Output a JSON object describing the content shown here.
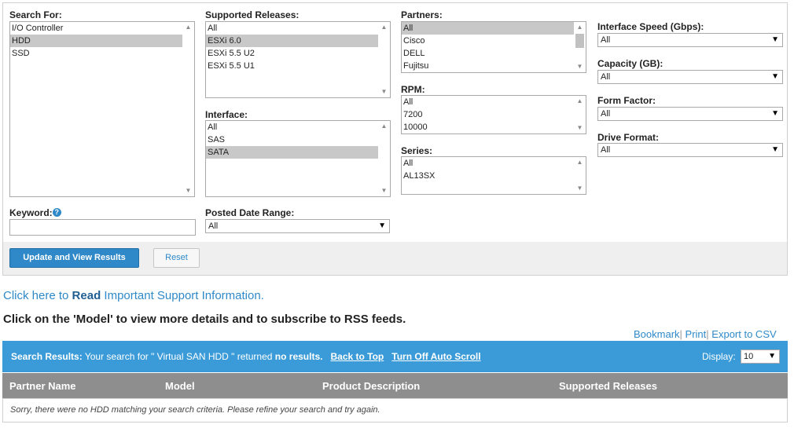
{
  "filters": {
    "search_for": {
      "label": "Search For:",
      "options": [
        "I/O Controller",
        "HDD",
        "SSD"
      ],
      "selected": "HDD"
    },
    "supported_releases": {
      "label": "Supported Releases:",
      "options": [
        "All",
        "ESXi 6.0",
        "ESXi 5.5 U2",
        "ESXi 5.5 U1"
      ],
      "selected": "ESXi 6.0"
    },
    "interface": {
      "label": "Interface:",
      "options": [
        "All",
        "SAS",
        "SATA"
      ],
      "selected": "SATA"
    },
    "partners": {
      "label": "Partners:",
      "options": [
        "All",
        "Cisco",
        "DELL",
        "Fujitsu"
      ],
      "selected": "All"
    },
    "rpm": {
      "label": "RPM:",
      "options": [
        "All",
        "7200",
        "10000"
      ]
    },
    "series": {
      "label": "Series:",
      "options": [
        "All",
        "AL13SX"
      ]
    },
    "interface_speed": {
      "label": "Interface Speed (Gbps):",
      "value": "All"
    },
    "capacity": {
      "label": "Capacity (GB):",
      "value": "All"
    },
    "form_factor": {
      "label": "Form Factor:",
      "value": "All"
    },
    "drive_format": {
      "label": "Drive Format:",
      "value": "All"
    },
    "keyword": {
      "label": "Keyword:",
      "value": "",
      "help_icon": "?"
    },
    "posted_date_range": {
      "label": "Posted Date Range:",
      "value": "All"
    }
  },
  "buttons": {
    "update": "Update and View Results",
    "reset": "Reset"
  },
  "support_link": {
    "prefix": "Click here to ",
    "bold": "Read",
    "suffix": " Important Support Information."
  },
  "instruction": "Click on the 'Model' to view more details and to subscribe to RSS feeds.",
  "actions": {
    "bookmark": "Bookmark",
    "print": "Print",
    "export": "Export to CSV",
    "separator": "|"
  },
  "results_bar": {
    "label": "Search Results:",
    "text_before": " Your search for \" Virtual SAN HDD \" returned ",
    "no_results": "no results.",
    "back_to_top": "Back to Top",
    "auto_scroll": "Turn Off Auto Scroll",
    "display_label": "Display:",
    "display_value": "10"
  },
  "table": {
    "columns": [
      "Partner Name",
      "Model",
      "Product Description",
      "Supported Releases"
    ],
    "empty_message": "Sorry, there were no HDD matching your search criteria. Please refine your search and try again."
  },
  "colors": {
    "accent": "#2f89c8",
    "results_bar": "#3a9bd8",
    "header_gray": "#8e8e8e",
    "selected_option": "#c8c8c8"
  }
}
